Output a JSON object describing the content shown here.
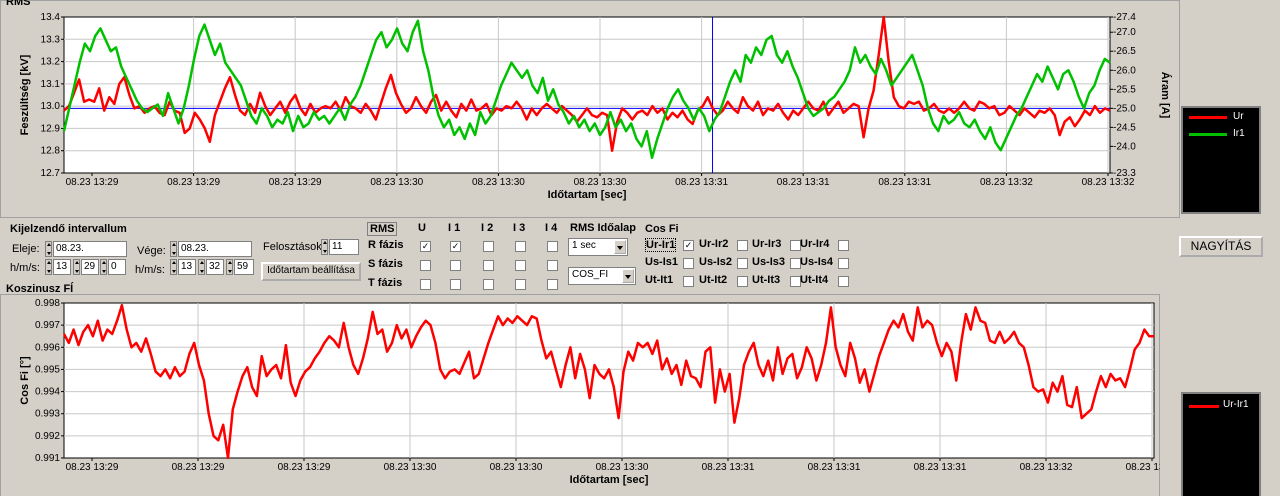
{
  "rms_panel": {
    "title": "RMS"
  },
  "cos_panel": {
    "title": "Koszinusz FÍ"
  },
  "zoom_button": "NAGYÍTÁS",
  "legend_top": [
    {
      "label": "Ur",
      "color": "#ff0000"
    },
    {
      "label": "Ir1",
      "color": "#00c000"
    }
  ],
  "legend_bottom": [
    {
      "label": "Ur-Ir1",
      "color": "#ff0000"
    }
  ],
  "interval": {
    "title": "Kijelzendő intervallum",
    "start_label": "Eleje:",
    "start_date": "08.23.",
    "start_hms_label": "h/m/s:",
    "start_h": "13",
    "start_m": "29",
    "start_s": "0",
    "end_label": "Vége:",
    "end_date": "08.23.",
    "end_hms_label": "h/m/s:",
    "end_h": "13",
    "end_m": "32",
    "end_s": "59",
    "divisions_label": "Felosztások",
    "divisions": "11",
    "set_button": "Időtartam beállítása"
  },
  "rms_table": {
    "header": "RMS",
    "columns": [
      "U",
      "I 1",
      "I 2",
      "I 3",
      "I 4"
    ],
    "rows": [
      {
        "label": "R fázis",
        "checked": [
          true,
          true,
          false,
          false,
          false
        ]
      },
      {
        "label": "S fázis",
        "checked": [
          false,
          false,
          false,
          false,
          false
        ]
      },
      {
        "label": "T fázis",
        "checked": [
          false,
          false,
          false,
          false,
          false
        ]
      }
    ]
  },
  "timebase": {
    "label": "RMS Időalap",
    "value": "1 sec",
    "cos_value": "COS_FI"
  },
  "cosfi": {
    "header": "Cos Fi",
    "rows": [
      [
        {
          "label": "Ur-Ir1",
          "checked": true
        },
        {
          "label": "Ur-Ir2",
          "checked": false
        },
        {
          "label": "Ur-Ir3",
          "checked": false
        },
        {
          "label": "Ur-Ir4",
          "checked": false
        }
      ],
      [
        {
          "label": "Us-Is1",
          "checked": false
        },
        {
          "label": "Us-Is2",
          "checked": false
        },
        {
          "label": "Us-Is3",
          "checked": false
        },
        {
          "label": "Us-Is4",
          "checked": false
        }
      ],
      [
        {
          "label": "Ut-It1",
          "checked": false
        },
        {
          "label": "Ut-It2",
          "checked": false
        },
        {
          "label": "Ut-It3",
          "checked": false
        },
        {
          "label": "Ut-It4",
          "checked": false
        }
      ]
    ]
  },
  "chart_data": [
    {
      "type": "line",
      "title": "RMS",
      "xlabel": "Időtartam [sec]",
      "ylabel": "Feszültség [kV]",
      "y2label": "Áram [A]",
      "ylim": [
        12.7,
        13.4
      ],
      "y2lim": [
        23.3,
        27.4
      ],
      "yticks": [
        "12.7",
        "12.8",
        "12.9",
        "13.0",
        "13.1",
        "13.2",
        "13.3",
        "13.4"
      ],
      "y2ticks": [
        "-23.3",
        "-24.0",
        "-24.5",
        "-25.0",
        "-25.5",
        "-26.0",
        "-26.5",
        "-27.0",
        "-27.4"
      ],
      "xticks": [
        "08.23 13:29",
        "08.23 13:29",
        "08.23 13:29",
        "08.23 13:30",
        "08.23 13:30",
        "08.23 13:30",
        "08.23 13:31",
        "08.23 13:31",
        "08.23 13:31",
        "08.23 13:32",
        "08.23 13:32"
      ],
      "grid": true,
      "cursor_x": 0.62,
      "hline_y": 12.99,
      "series": [
        {
          "name": "Ur",
          "color": "#ff0000",
          "axis": "left",
          "values": [
            12.98,
            13.0,
            13.06,
            13.12,
            13.02,
            13.03,
            13.02,
            13.08,
            12.98,
            13.04,
            13.01,
            13.1,
            13.13,
            13.05,
            12.99,
            13.0,
            12.97,
            12.99,
            13.0,
            12.97,
            12.96,
            13.02,
            12.98,
            12.97,
            12.88,
            12.9,
            12.97,
            12.94,
            12.9,
            12.84,
            12.96,
            13.02,
            13.08,
            13.13,
            13.05,
            12.98,
            12.96,
            13.01,
            12.97,
            13.06,
            13.0,
            12.96,
            12.99,
            13.02,
            12.97,
            13.02,
            13.05,
            12.99,
            12.96,
            13.01,
            12.97,
            12.99,
            13.0,
            12.99,
            13.02,
            12.98,
            13.04,
            13.0,
            12.99,
            12.97,
            13.01,
            12.98,
            12.94,
            13.01,
            13.08,
            13.14,
            13.06,
            13.01,
            12.97,
            12.99,
            13.04,
            13.0,
            12.97,
            13.02,
            13.05,
            12.98,
            13.02,
            12.98,
            12.95,
            13.01,
            12.98,
            13.03,
            12.98,
            12.99,
            13.01,
            12.96,
            12.99,
            12.98,
            13.0,
            12.99,
            13.02,
            12.99,
            12.94,
            12.99,
            12.96,
            12.99,
            13.01,
            12.99,
            12.97,
            13.0,
            12.98,
            12.96,
            12.93,
            12.96,
            12.99,
            12.96,
            12.95,
            12.97,
            12.96,
            12.8,
            12.93,
            12.99,
            12.97,
            12.94,
            12.97,
            12.98,
            12.96,
            13.0,
            12.97,
            12.99,
            12.94,
            12.97,
            12.95,
            12.98,
            12.94,
            12.92,
            12.98,
            13.0,
            13.04,
            12.99,
            12.96,
            12.98,
            13.02,
            12.99,
            12.97,
            13.04,
            13.0,
            12.98,
            13.02,
            12.96,
            12.99,
            12.98,
            13.01,
            12.97,
            12.94,
            12.98,
            12.96,
            12.99,
            13.02,
            12.99,
            12.98,
            13.02,
            12.96,
            12.99,
            13.02,
            12.97,
            12.99,
            13.01,
            13.0,
            12.86,
            12.99,
            13.07,
            13.23,
            13.41,
            13.2,
            13.04,
            13.0,
            12.99,
            13.02,
            13.01,
            13.02,
            12.98,
            12.99,
            13.01,
            12.98,
            12.97,
            12.99,
            12.97,
            12.99,
            13.02,
            12.99,
            12.98,
            13.02,
            13.01,
            12.99,
            13.0,
            12.96,
            12.97,
            13.0,
            12.98,
            12.96,
            12.99,
            12.97,
            12.95,
            12.98,
            12.97,
            12.99,
            12.96,
            12.87,
            12.93,
            12.95,
            12.91,
            12.94,
            12.98,
            12.96,
            13.0,
            12.97,
            12.99,
            12.98
          ]
        },
        {
          "name": "Ir1",
          "color": "#00c000",
          "axis": "right",
          "values": [
            24.4,
            25.0,
            25.6,
            26.2,
            26.7,
            26.5,
            26.9,
            27.1,
            26.8,
            26.5,
            26.6,
            26.1,
            25.8,
            25.5,
            25.2,
            25.0,
            24.9,
            25.0,
            25.1,
            24.8,
            25.4,
            25.0,
            24.6,
            25.0,
            25.6,
            26.3,
            26.9,
            27.2,
            26.8,
            26.4,
            26.7,
            26.2,
            26.0,
            25.8,
            25.6,
            25.2,
            24.8,
            24.6,
            25.0,
            24.8,
            24.5,
            24.7,
            24.6,
            24.9,
            24.4,
            24.8,
            24.5,
            24.6,
            24.9,
            24.7,
            24.8,
            24.6,
            24.8,
            25.0,
            24.7,
            25.1,
            25.3,
            25.6,
            26.0,
            26.4,
            26.8,
            27.0,
            26.6,
            26.8,
            27.1,
            26.7,
            26.5,
            27.0,
            27.3,
            26.5,
            26.0,
            25.3,
            24.8,
            24.5,
            24.7,
            24.3,
            24.5,
            24.2,
            24.6,
            24.3,
            24.9,
            24.6,
            24.8,
            25.2,
            25.6,
            25.9,
            26.2,
            26.0,
            25.8,
            26.0,
            25.6,
            25.4,
            25.8,
            25.2,
            25.5,
            25.1,
            24.9,
            24.6,
            24.8,
            24.5,
            24.7,
            24.4,
            24.6,
            24.3,
            24.5,
            24.9,
            24.5,
            24.7,
            24.4,
            24.6,
            24.2,
            24.0,
            24.4,
            23.7,
            24.2,
            24.6,
            25.0,
            25.3,
            25.5,
            25.2,
            25.0,
            24.7,
            25.0,
            24.8,
            24.4,
            24.7,
            24.9,
            25.3,
            25.7,
            26.0,
            25.7,
            26.4,
            26.2,
            26.6,
            26.4,
            26.8,
            26.9,
            26.4,
            26.2,
            26.5,
            26.1,
            25.8,
            25.4,
            25.0,
            24.8,
            24.9,
            25.0,
            25.2,
            25.3,
            25.5,
            25.7,
            26.0,
            26.6,
            26.2,
            26.4,
            26.1,
            25.9,
            26.3,
            26.0,
            25.6,
            25.8,
            26.0,
            26.2,
            26.4,
            26.0,
            25.6,
            25.0,
            24.6,
            24.4,
            24.8,
            24.6,
            24.7,
            24.9,
            24.6,
            24.5,
            24.7,
            24.4,
            24.2,
            24.5,
            24.1,
            23.9,
            24.2,
            24.5,
            24.8,
            25.0,
            25.3,
            25.6,
            25.9,
            25.7,
            26.1,
            25.8,
            25.5,
            25.9,
            26.0,
            25.7,
            25.3,
            25.0,
            25.4,
            25.6,
            26.0,
            26.3,
            26.2
          ]
        }
      ]
    },
    {
      "type": "line",
      "title": "Koszinusz FÍ",
      "xlabel": "Időtartam [sec]",
      "ylabel": "Cos Fi [°]",
      "ylim": [
        0.991,
        0.998
      ],
      "yticks": [
        "0.991",
        "0.992",
        "0.993",
        "0.994",
        "0.995",
        "0.996",
        "0.997",
        "0.998"
      ],
      "xticks": [
        "08.23 13:29",
        "08.23 13:29",
        "08.23 13:29",
        "08.23 13:30",
        "08.23 13:30",
        "08.23 13:30",
        "08.23 13:31",
        "08.23 13:31",
        "08.23 13:31",
        "08.23 13:32",
        "08.23 13:32"
      ],
      "grid": true,
      "series": [
        {
          "name": "Ur-Ir1",
          "color": "#ff0000",
          "values": [
            0.9966,
            0.9962,
            0.9968,
            0.9961,
            0.9967,
            0.997,
            0.9965,
            0.9972,
            0.9963,
            0.9968,
            0.9966,
            0.9972,
            0.9979,
            0.9968,
            0.996,
            0.9962,
            0.9958,
            0.9964,
            0.9957,
            0.9949,
            0.9947,
            0.995,
            0.9946,
            0.9951,
            0.9947,
            0.9949,
            0.9957,
            0.9962,
            0.9952,
            0.9945,
            0.993,
            0.992,
            0.9918,
            0.9925,
            0.9909,
            0.9932,
            0.994,
            0.9947,
            0.9951,
            0.9942,
            0.9938,
            0.9956,
            0.9947,
            0.995,
            0.9952,
            0.9946,
            0.9961,
            0.9944,
            0.9938,
            0.9945,
            0.9949,
            0.9951,
            0.9955,
            0.9958,
            0.9962,
            0.9965,
            0.9963,
            0.996,
            0.9971,
            0.996,
            0.9952,
            0.9948,
            0.9955,
            0.9964,
            0.9976,
            0.9966,
            0.9968,
            0.9958,
            0.9962,
            0.997,
            0.9964,
            0.9968,
            0.996,
            0.9965,
            0.9969,
            0.9972,
            0.997,
            0.9962,
            0.995,
            0.9946,
            0.9949,
            0.995,
            0.9948,
            0.9953,
            0.9958,
            0.9946,
            0.9948,
            0.9955,
            0.9962,
            0.9968,
            0.9974,
            0.997,
            0.9973,
            0.9971,
            0.9974,
            0.9972,
            0.997,
            0.9974,
            0.9973,
            0.9963,
            0.9955,
            0.9958,
            0.995,
            0.9942,
            0.9952,
            0.996,
            0.9946,
            0.9957,
            0.995,
            0.9937,
            0.9952,
            0.9948,
            0.9946,
            0.995,
            0.9942,
            0.9928,
            0.9949,
            0.9958,
            0.9954,
            0.9962,
            0.996,
            0.9962,
            0.9957,
            0.9963,
            0.995,
            0.9955,
            0.9948,
            0.9952,
            0.9943,
            0.9954,
            0.9947,
            0.9946,
            0.9942,
            0.9958,
            0.996,
            0.9935,
            0.995,
            0.994,
            0.9948,
            0.9926,
            0.9937,
            0.9952,
            0.9958,
            0.9962,
            0.9952,
            0.9947,
            0.9954,
            0.9945,
            0.996,
            0.9948,
            0.9955,
            0.9957,
            0.9946,
            0.9951,
            0.996,
            0.9955,
            0.9945,
            0.9952,
            0.9962,
            0.9978,
            0.996,
            0.9952,
            0.9947,
            0.9962,
            0.9955,
            0.9944,
            0.995,
            0.994,
            0.9948,
            0.9956,
            0.9962,
            0.9968,
            0.9972,
            0.9969,
            0.9975,
            0.9967,
            0.9963,
            0.9978,
            0.9969,
            0.9972,
            0.997,
            0.9962,
            0.9956,
            0.9962,
            0.9958,
            0.9945,
            0.9962,
            0.9975,
            0.9968,
            0.9978,
            0.9972,
            0.9971,
            0.9963,
            0.9962,
            0.9967,
            0.9962,
            0.9964,
            0.9967,
            0.9962,
            0.996,
            0.9952,
            0.9942,
            0.994,
            0.9941,
            0.9935,
            0.9944,
            0.994,
            0.9947,
            0.9934,
            0.9933,
            0.9942,
            0.9928,
            0.993,
            0.9932,
            0.994,
            0.9947,
            0.9942,
            0.9948,
            0.9945,
            0.9946,
            0.9942,
            0.995,
            0.9959,
            0.9962,
            0.9968,
            0.9965,
            0.9965
          ]
        }
      ]
    }
  ]
}
